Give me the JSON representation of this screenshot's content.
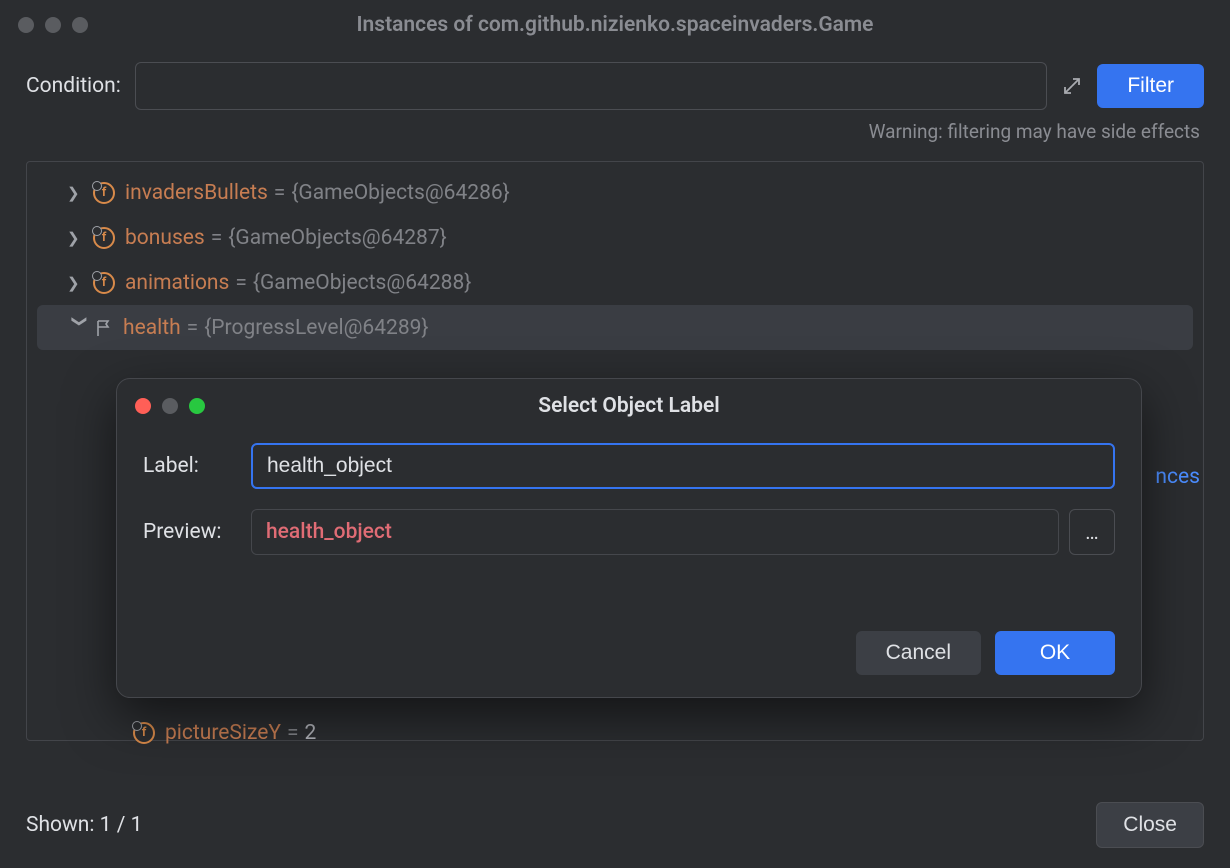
{
  "window": {
    "title": "Instances of com.github.nizienko.spaceinvaders.Game"
  },
  "condition": {
    "label": "Condition:",
    "value": "",
    "warning": "Warning: filtering may have side effects",
    "filter_label": "Filter"
  },
  "tree": {
    "items": [
      {
        "name": "invadersBullets",
        "value": "{GameObjects@64286}",
        "expanded": false,
        "selected": false,
        "icon": "field",
        "hasChevron": true
      },
      {
        "name": "bonuses",
        "value": "{GameObjects@64287}",
        "expanded": false,
        "selected": false,
        "icon": "field",
        "hasChevron": true
      },
      {
        "name": "animations",
        "value": "{GameObjects@64288}",
        "expanded": false,
        "selected": false,
        "icon": "field",
        "hasChevron": true
      },
      {
        "name": "health",
        "value": "{ProgressLevel@64289}",
        "expanded": true,
        "selected": true,
        "icon": "flag",
        "hasChevron": true
      }
    ],
    "subitem": {
      "name": "pictureSizeY",
      "value": "2"
    }
  },
  "modal": {
    "title": "Select Object Label",
    "label_label": "Label:",
    "label_value": "health_object",
    "preview_label": "Preview:",
    "preview_value": "health_object",
    "cancel": "Cancel",
    "ok": "OK",
    "dots": "…"
  },
  "link": {
    "text": "nces"
  },
  "footer": {
    "shown": "Shown: 1 / 1",
    "close": "Close"
  }
}
